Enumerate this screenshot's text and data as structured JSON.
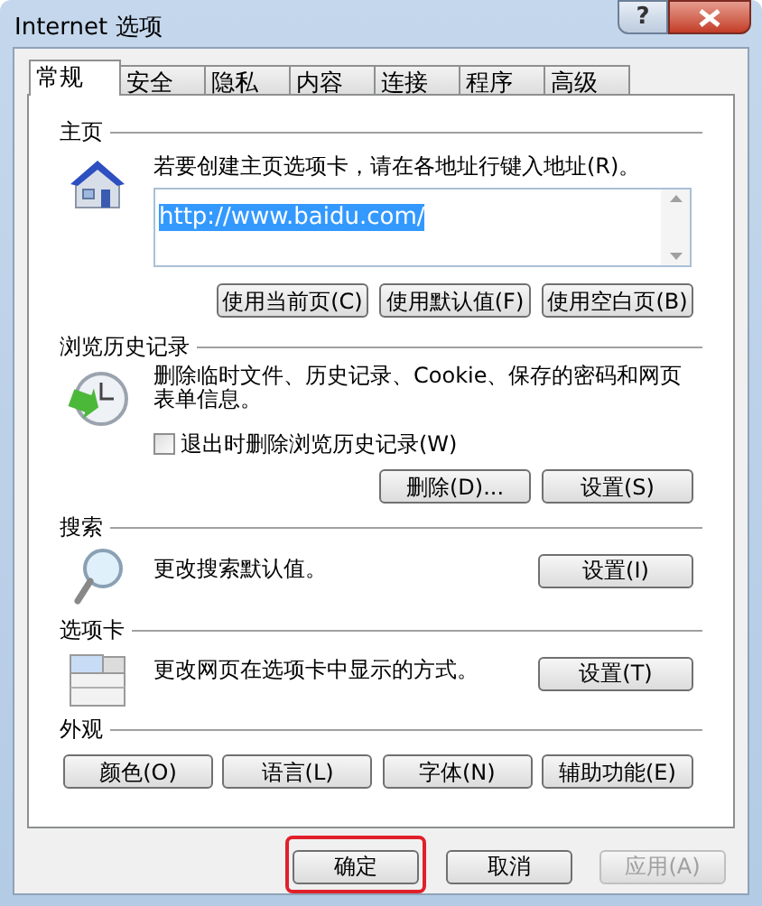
{
  "window": {
    "title": "Internet 选项",
    "help_button": "?"
  },
  "tabs": [
    {
      "label": "常规",
      "selected": true
    },
    {
      "label": "安全",
      "selected": false
    },
    {
      "label": "隐私",
      "selected": false
    },
    {
      "label": "内容",
      "selected": false
    },
    {
      "label": "连接",
      "selected": false
    },
    {
      "label": "程序",
      "selected": false
    },
    {
      "label": "高级",
      "selected": false
    }
  ],
  "home_page": {
    "heading": "主页",
    "description": "若要创建主页选项卡，请在各地址行键入地址(R)。",
    "address": {
      "value": "http://www.baidu.com/",
      "selected": true
    },
    "buttons": [
      "使用当前页(C)",
      "使用默认值(F)",
      "使用空白页(B)"
    ]
  },
  "browsing_history": {
    "heading": "浏览历史记录",
    "description": "删除临时文件、历史记录、Cookie、保存的密码和网页表单信息。",
    "checkbox": {
      "label": "退出时删除浏览历史记录(W)",
      "checked": false
    },
    "buttons": [
      "删除(D)...",
      "设置(S)"
    ]
  },
  "search": {
    "heading": "搜索",
    "description": "更改搜索默认值。",
    "button": "设置(I)"
  },
  "tabs_section": {
    "heading": "选项卡",
    "description": "更改网页在选项卡中显示的方式。",
    "button": "设置(T)"
  },
  "appearance": {
    "heading": "外观",
    "buttons": [
      "颜色(O)",
      "语言(L)",
      "字体(N)",
      "辅助功能(E)"
    ]
  },
  "footer_buttons": [
    {
      "label": "确定",
      "disabled": false,
      "highlighted": true
    },
    {
      "label": "取消",
      "disabled": false,
      "highlighted": false
    },
    {
      "label": "应用(A)",
      "disabled": true,
      "highlighted": false
    }
  ]
}
